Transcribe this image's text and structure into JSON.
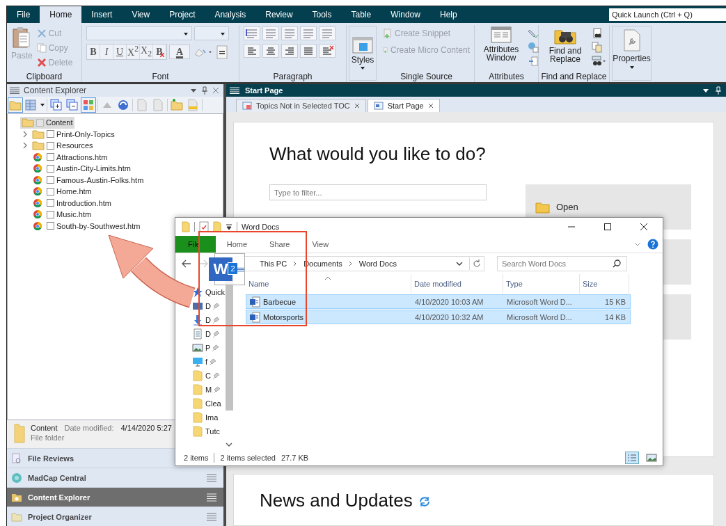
{
  "menu_tabs": [
    {
      "label": "File",
      "selected": false
    },
    {
      "label": "Home",
      "selected": true
    },
    {
      "label": "Insert",
      "selected": false
    },
    {
      "label": "View",
      "selected": false
    },
    {
      "label": "Project",
      "selected": false
    },
    {
      "label": "Analysis",
      "selected": false
    },
    {
      "label": "Review",
      "selected": false
    },
    {
      "label": "Tools",
      "selected": false
    },
    {
      "label": "Table",
      "selected": false
    },
    {
      "label": "Window",
      "selected": false
    },
    {
      "label": "Help",
      "selected": false
    }
  ],
  "quick_launch": {
    "placeholder": "Quick Launch (Ctrl + Q)"
  },
  "ribbon": {
    "clipboard": {
      "label": "Clipboard",
      "paste": {
        "label": "Paste",
        "disabled": true
      },
      "actions": [
        {
          "label": "Cut",
          "kind": "cut",
          "disabled": true
        },
        {
          "label": "Copy",
          "kind": "copy",
          "disabled": true
        },
        {
          "label": "Delete",
          "kind": "delete",
          "disabled": true
        }
      ]
    },
    "font": {
      "label": "Font",
      "formats": [
        {
          "glyph": "B",
          "kind": "bold"
        },
        {
          "glyph": "I",
          "kind": "italic"
        },
        {
          "glyph": "U",
          "kind": "underline"
        },
        {
          "glyph": "X$^{2}$",
          "kind": "superscript"
        },
        {
          "glyph": "X$_{2}$",
          "kind": "subscript"
        },
        {
          "glyph": "B",
          "kind": "clear"
        }
      ],
      "color_glyph": "A"
    },
    "paragraph": {
      "label": "Paragraph"
    },
    "styles": {
      "label": "Styles"
    },
    "single_source": {
      "label": "Single Source",
      "actions": [
        {
          "label": "Create Snippet",
          "disabled": true
        },
        {
          "label": "Create Micro Content",
          "disabled": true
        }
      ]
    },
    "attributes": {
      "label": "Attributes",
      "button": "Attributes Window"
    },
    "find_replace": {
      "label": "Find and Replace",
      "button": "Find and Replace"
    },
    "properties": {
      "label": "Properties"
    }
  },
  "left_panel": {
    "title": "Content Explorer",
    "tree": {
      "label": "Content",
      "selected": true,
      "checked": false,
      "children": [
        {
          "label": "Print-Only-Topics",
          "kind": "folder",
          "expanded": false,
          "checked": false,
          "selected": false
        },
        {
          "label": "Resources",
          "kind": "folder",
          "expanded": false,
          "checked": false,
          "selected": false
        },
        {
          "label": "Attractions.htm",
          "kind": "page",
          "checked": false,
          "selected": false
        },
        {
          "label": "Austin-City-Limits.htm",
          "kind": "page",
          "checked": false,
          "selected": false
        },
        {
          "label": "Famous-Austin-Folks.htm",
          "kind": "page",
          "checked": false,
          "selected": false
        },
        {
          "label": "Home.htm",
          "kind": "page",
          "checked": false,
          "selected": false
        },
        {
          "label": "Introduction.htm",
          "kind": "page",
          "checked": false,
          "selected": false
        },
        {
          "label": "Music.htm",
          "kind": "page",
          "checked": false,
          "selected": false
        },
        {
          "label": "South-by-Southwest.htm",
          "kind": "page",
          "checked": false,
          "selected": false
        }
      ]
    },
    "info": {
      "name": "Content",
      "date_label": "Date modified:",
      "date": "4/14/2020 5:27",
      "type": "File folder"
    },
    "nav": [
      {
        "label": "File Reviews",
        "kind": "reviews",
        "selected": false
      },
      {
        "label": "MadCap Central",
        "kind": "central",
        "selected": false
      },
      {
        "label": "Content Explorer",
        "kind": "explorer",
        "selected": true
      },
      {
        "label": "Project Organizer",
        "kind": "organizer",
        "selected": false
      }
    ]
  },
  "right_pane": {
    "title": "Start Page",
    "doc_tabs": [
      {
        "label": "Topics Not in Selected TOC",
        "selected": false
      },
      {
        "label": "Start Page",
        "selected": true
      }
    ],
    "heading": "What would you like to do?",
    "filter": {
      "placeholder": "Type to filter..."
    },
    "tiles": [
      {
        "label": "Open"
      }
    ],
    "news_heading": "News and Updates"
  },
  "explorer": {
    "title": "Word Docs",
    "tabs": [
      {
        "label": "File",
        "kind": "file"
      },
      {
        "label": "Home",
        "kind": "tab"
      },
      {
        "label": "Share",
        "kind": "tab"
      },
      {
        "label": "View",
        "kind": "tab"
      }
    ],
    "address": [
      "This PC",
      "Documents",
      "Word Docs"
    ],
    "search": {
      "placeholder": "Search Word Docs"
    },
    "nav": [
      {
        "label": "Quick",
        "kind": "star",
        "pinned": false
      },
      {
        "label": "D",
        "kind": "desktop",
        "pinned": true
      },
      {
        "label": "D",
        "kind": "download",
        "pinned": true
      },
      {
        "label": "D",
        "kind": "document",
        "pinned": true
      },
      {
        "label": "P",
        "kind": "pictures",
        "pinned": true
      },
      {
        "label": "f",
        "kind": "monitor",
        "pinned": true
      },
      {
        "label": "C",
        "kind": "folder",
        "pinned": true
      },
      {
        "label": "M",
        "kind": "folder",
        "pinned": true
      },
      {
        "label": "Clea",
        "kind": "folder",
        "pinned": false
      },
      {
        "label": "Ima",
        "kind": "folder",
        "pinned": false
      },
      {
        "label": "Tutc",
        "kind": "folder",
        "pinned": false
      }
    ],
    "columns": [
      "Name",
      "Date modified",
      "Type",
      "Size"
    ],
    "rows": [
      {
        "name": "Barbecue",
        "date": "4/10/2020 10:03 AM",
        "type": "Microsoft Word D...",
        "size": "15 KB",
        "selected": true
      },
      {
        "name": "Motorsports",
        "date": "4/10/2020 10:32 AM",
        "type": "Microsoft Word D...",
        "size": "14 KB",
        "selected": true
      }
    ],
    "status": {
      "count": "2 items",
      "selection": "2 items selected",
      "size": "27.7 KB"
    }
  },
  "drag_ghost": {
    "logo": "W",
    "count": "2"
  }
}
